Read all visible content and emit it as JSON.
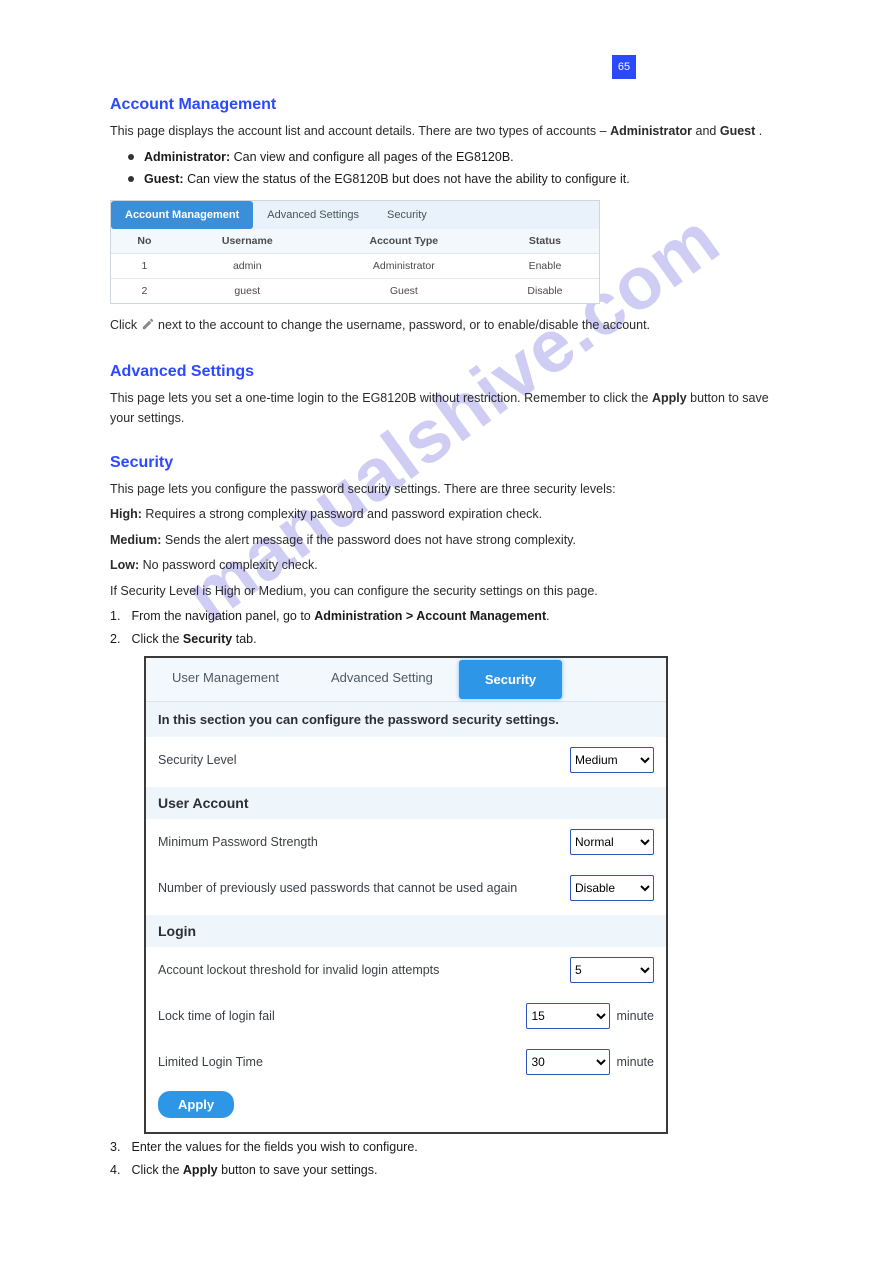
{
  "meta": {
    "page_number": "65",
    "watermark": "manualshive.com"
  },
  "body": {
    "h_account": "Account Management",
    "p_account": [
      "This page displays the account list and account details. There are two types of accounts – ",
      "Administrator",
      " and ",
      "Guest",
      "."
    ],
    "li1": [
      "Administrator:",
      " Can view and configure all pages of the EG8120B."
    ],
    "li2": [
      "Guest:",
      " Can view the status of the EG8120B but does not have the ability to configure it."
    ],
    "p_click": [
      "Click ",
      " next to the account to change the username, password, or to enable/disable the account."
    ],
    "h_adv": "Advanced Settings",
    "p_adv": [
      "This page lets you set a one‑time login to the EG8120B without restriction. Remember to click the ",
      "Apply",
      " button to save your settings."
    ],
    "h_sec": "Security",
    "p_sec1": "This page lets you configure the password security settings. There are three security levels:",
    "lvl_hi": [
      "High:",
      " Requires a strong complexity password and password expiration check."
    ],
    "lvl_md": [
      "Medium:",
      " Sends the alert message if the password does not have strong complexity."
    ],
    "lvl_lo": [
      "Low:",
      " No password complexity check."
    ],
    "lvl_lo2": "If Security Level is High or Medium, you can configure the security settings on this page.",
    "step1": [
      "1.",
      "From the navigation panel, go to",
      " Administration > Account Management",
      "."
    ],
    "step2": [
      "2.",
      "Click the",
      " Security",
      " tab."
    ],
    "step3": [
      "3.",
      "Enter the values for the fields you wish to configure."
    ],
    "step4": [
      "4.",
      "Click the",
      "Apply",
      "button to save your settings."
    ]
  },
  "fig1": {
    "tabs": [
      "Account Management",
      "Advanced Settings",
      "Security"
    ],
    "headers": [
      "No",
      "Username",
      "Account Type",
      "Status"
    ],
    "rows": [
      [
        "1",
        "admin",
        "Administrator",
        "Enable"
      ],
      [
        "2",
        "guest",
        "Guest",
        "Disable"
      ]
    ]
  },
  "fig2": {
    "tabs": [
      "User Management",
      "Advanced Setting",
      "Security"
    ],
    "desc": "In this section you can configure the password security settings.",
    "r1": {
      "label": "Security Level",
      "value": "Medium"
    },
    "h_user": "User Account",
    "r2": {
      "label": "Minimum Password Strength",
      "value": "Normal"
    },
    "r3": {
      "label": "Number of previously used passwords that cannot be used again",
      "value": "Disable"
    },
    "h_login": "Login",
    "r4": {
      "label": "Account lockout threshold for invalid login attempts",
      "value": "5"
    },
    "r5": {
      "label": "Lock time of login fail",
      "value": "15",
      "unit": "minute"
    },
    "r6": {
      "label": "Limited Login Time",
      "value": "30",
      "unit": "minute"
    },
    "apply": "Apply"
  }
}
